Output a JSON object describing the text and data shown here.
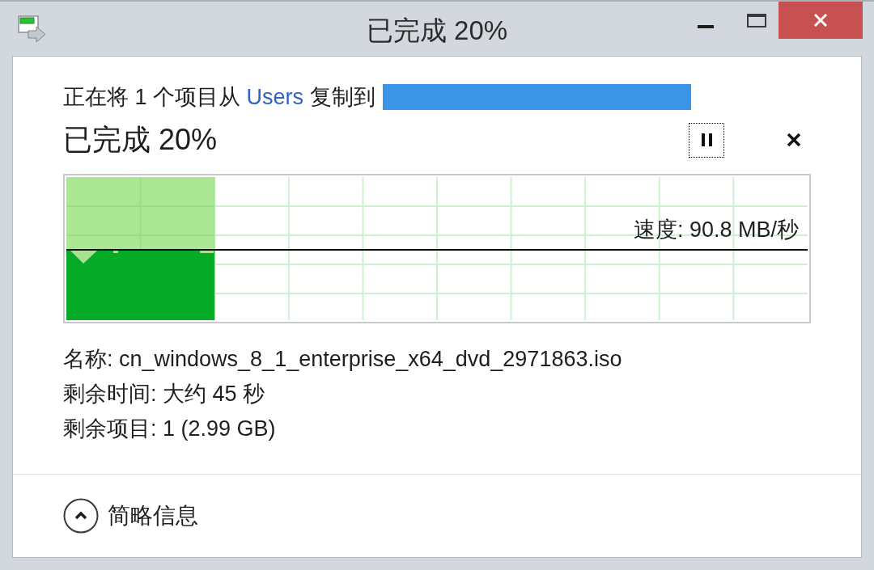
{
  "window": {
    "title": "已完成 20%"
  },
  "copy_line": {
    "before": "正在将 1 个项目从",
    "source": "Users",
    "after": "复制到"
  },
  "progress": {
    "heading": "已完成 20%"
  },
  "pause_button": {
    "focused": true
  },
  "graph": {
    "level": 0.2,
    "speed": "速度: 90.8 MB/秒"
  },
  "details": [
    "名称: cn_windows_8_1_enterprise_x64_dvd_2971863.iso",
    "剩余时间: 大约 45 秒",
    "剩余项目: 1 (2.99 GB)"
  ],
  "footer": {
    "label": "简略信息",
    "expanded": true
  }
}
